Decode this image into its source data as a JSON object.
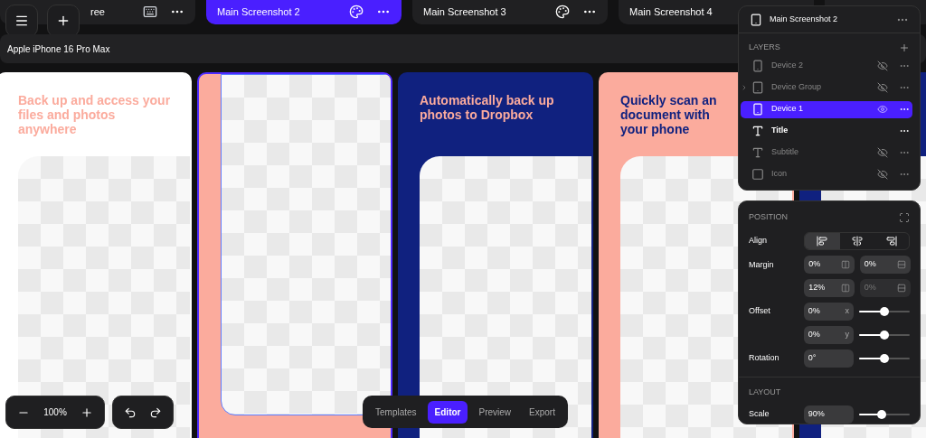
{
  "screenshot_tabs": [
    {
      "title": "ree",
      "selected": false,
      "kind": "keyboard"
    },
    {
      "title": "Main Screenshot 2",
      "selected": true,
      "kind": "palette"
    },
    {
      "title": "Main Screenshot 3",
      "selected": false,
      "kind": "palette"
    },
    {
      "title": "Main Screenshot 4",
      "selected": false,
      "kind": "plain"
    }
  ],
  "device_bar": {
    "label": "Apple iPhone 16 Pro Max"
  },
  "screens": [
    {
      "title": "Back up and access your files and photos anywhere",
      "kind": "light",
      "selected": false
    },
    {
      "kind": "salmon",
      "selected": true
    },
    {
      "title": "Automatically back up photos to Dropbox",
      "kind": "navy",
      "selected": false
    },
    {
      "title": "Quickly scan an document with your phone",
      "kind": "salmon",
      "selected": false
    },
    {
      "kind": "navy",
      "selected": false
    }
  ],
  "layers_panel": {
    "title": "Main Screenshot 2",
    "heading": "LAYERS",
    "layers": [
      {
        "name": "Device 2",
        "kind": "phone",
        "hidden": true,
        "selected": false,
        "expandable": false
      },
      {
        "name": "Device Group",
        "kind": "group",
        "hidden": true,
        "selected": false,
        "expandable": true
      },
      {
        "name": "Device 1",
        "kind": "phone",
        "hidden": false,
        "selected": true,
        "expandable": false
      },
      {
        "name": "Title",
        "kind": "text",
        "hidden": false,
        "selected": false,
        "expandable": false
      },
      {
        "name": "Subtitle",
        "kind": "text",
        "hidden": true,
        "selected": false,
        "expandable": false
      },
      {
        "name": "Icon",
        "kind": "square",
        "hidden": true,
        "selected": false,
        "expandable": false
      }
    ]
  },
  "position_panel": {
    "heading": "POSITION",
    "align_label": "Align",
    "align": [
      {
        "kind": "left",
        "selected": true
      },
      {
        "kind": "center",
        "selected": false
      },
      {
        "kind": "right",
        "selected": false
      }
    ],
    "margin_label": "Margin",
    "margins": [
      {
        "value": "0%",
        "disabled": false
      },
      {
        "value": "0%",
        "disabled": false
      },
      {
        "value": "12%",
        "disabled": false
      },
      {
        "value": "0%",
        "disabled": true
      }
    ],
    "offset_label": "Offset",
    "offsets": [
      {
        "value": "0%",
        "axis": "x",
        "level": 0.5
      },
      {
        "value": "0%",
        "axis": "y",
        "level": 0.5
      }
    ],
    "rotation_label": "Rotation",
    "rotation": {
      "value": "0°",
      "level": 0.5
    },
    "layout_heading": "LAYOUT",
    "scale_label": "Scale",
    "scale": {
      "value": "90%",
      "level": 0.45
    }
  },
  "zoom": {
    "value": "100%"
  },
  "modes": [
    {
      "label": "Templates",
      "selected": false
    },
    {
      "label": "Editor",
      "selected": true
    },
    {
      "label": "Preview",
      "selected": false
    },
    {
      "label": "Export",
      "selected": false
    }
  ]
}
